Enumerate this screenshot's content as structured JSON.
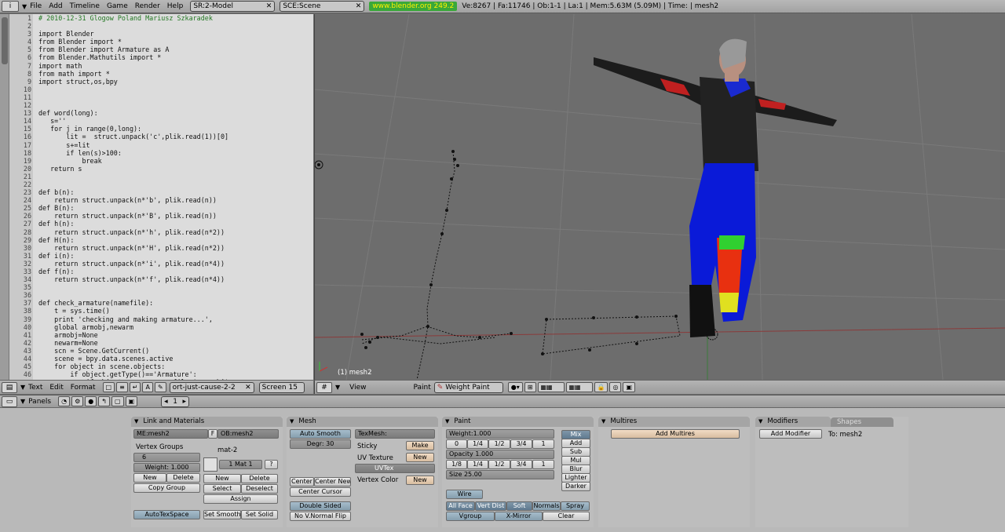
{
  "top": {
    "menus": [
      "File",
      "Add",
      "Timeline",
      "Game",
      "Render",
      "Help"
    ],
    "screen": "SR:2-Model",
    "scene": "SCE:Scene",
    "url": "www.blender.org 249.2",
    "stats": "Ve:8267 | Fa:11746 | Ob:1-1 | La:1  | Mem:5.63M (5.09M)  | Time: | mesh2"
  },
  "text_editor": {
    "line_numbers": [
      "1",
      "2",
      "3",
      "4",
      "5",
      "6",
      "7",
      "8",
      "9",
      "10",
      "11",
      "12",
      "13",
      "14",
      "15",
      "16",
      "17",
      "18",
      "19",
      "20",
      "21",
      "22",
      "23",
      "24",
      "25",
      "26",
      "27",
      "28",
      "29",
      "30",
      "31",
      "32",
      "33",
      "34",
      "35",
      "36",
      "37",
      "38",
      "39",
      "40",
      "41",
      "42",
      "43",
      "44",
      "45",
      "46"
    ],
    "lines": [
      "# 2010-12-31 Glogow Poland Mariusz Szkaradek",
      "",
      "import Blender",
      "from Blender import *",
      "from Blender import Armature as A",
      "from Blender.Mathutils import *",
      "import math",
      "from math import *",
      "import struct,os,bpy",
      "",
      "",
      "",
      "def word(long):",
      "   s=''",
      "   for j in range(0,long):",
      "       lit =  struct.unpack('c',plik.read(1))[0]",
      "       s+=lit",
      "       if len(s)>100:",
      "           break",
      "   return s",
      "",
      "",
      "def b(n):",
      "    return struct.unpack(n*'b', plik.read(n))",
      "def B(n):",
      "    return struct.unpack(n*'B', plik.read(n))",
      "def h(n):",
      "    return struct.unpack(n*'h', plik.read(n*2))",
      "def H(n):",
      "    return struct.unpack(n*'H', plik.read(n*2))",
      "def i(n):",
      "    return struct.unpack(n*'i', plik.read(n*4))",
      "def f(n):",
      "    return struct.unpack(n*'f', plik.read(n*4))",
      "",
      "",
      "def check_armature(namefile):",
      "    t = sys.time()",
      "    print 'checking and making armature...',",
      "    global armobj,newarm",
      "    armobj=None",
      "    newarm=None",
      "    scn = Scene.GetCurrent()",
      "    scene = bpy.data.scenes.active",
      "    for object in scene.objects:",
      "        if object.getType()=='Armature':",
      "            if object.name == namefile+'-armobj':"
    ],
    "header": {
      "menus": [
        "Text",
        "Edit",
        "Format"
      ],
      "text_name": "ort-just-cause-2-2",
      "font": "Screen 15"
    }
  },
  "viewport": {
    "object_label": "(1) mesh2",
    "header": {
      "view": "View",
      "paint": "Paint",
      "mode": "Weight Paint"
    }
  },
  "buttons_header": {
    "panels": "Panels",
    "frame": "1"
  },
  "link_materials": {
    "title": "Link and Materials",
    "me": "ME:mesh2",
    "f": "F",
    "ob": "OB:mesh2",
    "vgroups": "Vertex Groups",
    "vg_value": "6",
    "weight": "Weight: 1.000",
    "new": "New",
    "delete": "Delete",
    "copy_group": "Copy Group",
    "mat": "mat-2",
    "mat_sel": "1 Mat 1",
    "q": "?",
    "new2": "New",
    "delete2": "Delete",
    "select": "Select",
    "deselect": "Deselect",
    "assign": "Assign",
    "autotex": "AutoTexSpace",
    "set_smooth": "Set Smooth",
    "set_solid": "Set Solid"
  },
  "mesh": {
    "title": "Mesh",
    "auto_smooth": "Auto Smooth",
    "degr": "Degr: 30",
    "texmesh": "TexMesh:",
    "sticky": "Sticky",
    "make": "Make",
    "uvtex_lbl": "UV Texture",
    "new": "New",
    "uvtex": "UVTex",
    "vcol": "Vertex Color",
    "new2": "New",
    "center": "Center",
    "center_new": "Center New",
    "center_cursor": "Center Cursor",
    "double_sided": "Double Sided",
    "no_vnormal": "No V.Normal Flip"
  },
  "paint": {
    "title": "Paint",
    "weight": "Weight:1.000",
    "w": [
      "0",
      "1/4",
      "1/2",
      "3/4",
      "1"
    ],
    "opacity": "Opacity 1.000",
    "o": [
      "1/8",
      "1/4",
      "1/2",
      "3/4",
      "1"
    ],
    "size": "Size 25.00",
    "modes": [
      "Mix",
      "Add",
      "Sub",
      "Mul",
      "Blur",
      "Lighter",
      "Darker"
    ],
    "wire": "Wire",
    "all_face": "All Face",
    "vert_dist": "Vert Dist",
    "soft": "Soft",
    "normals": "Normals",
    "spray": "Spray",
    "vgroup": "Vgroup",
    "xmirror": "X-Mirror",
    "clear": "Clear"
  },
  "multires": {
    "title": "Multires",
    "add": "Add Multires"
  },
  "modifiers": {
    "tab1": "Modifiers",
    "tab2": "Shapes",
    "add": "Add Modifier",
    "to": "To: mesh2"
  }
}
